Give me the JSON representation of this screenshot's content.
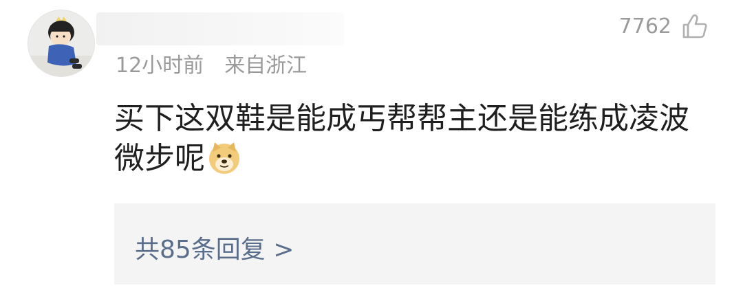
{
  "comment": {
    "like_count": "7762",
    "time": "12小时前",
    "location": "来自浙江",
    "text": "买下这双鞋是能成丐帮帮主还是能练成凌波微步呢",
    "emoji_icon": "doge-emoji-icon",
    "like_icon": "thumbs-up-icon"
  },
  "replies": {
    "label": "共85条回复 >"
  },
  "colors": {
    "meta_text": "#9a9a9a",
    "reply_link": "#5a6e8c",
    "reply_bg": "#f4f4f4"
  }
}
